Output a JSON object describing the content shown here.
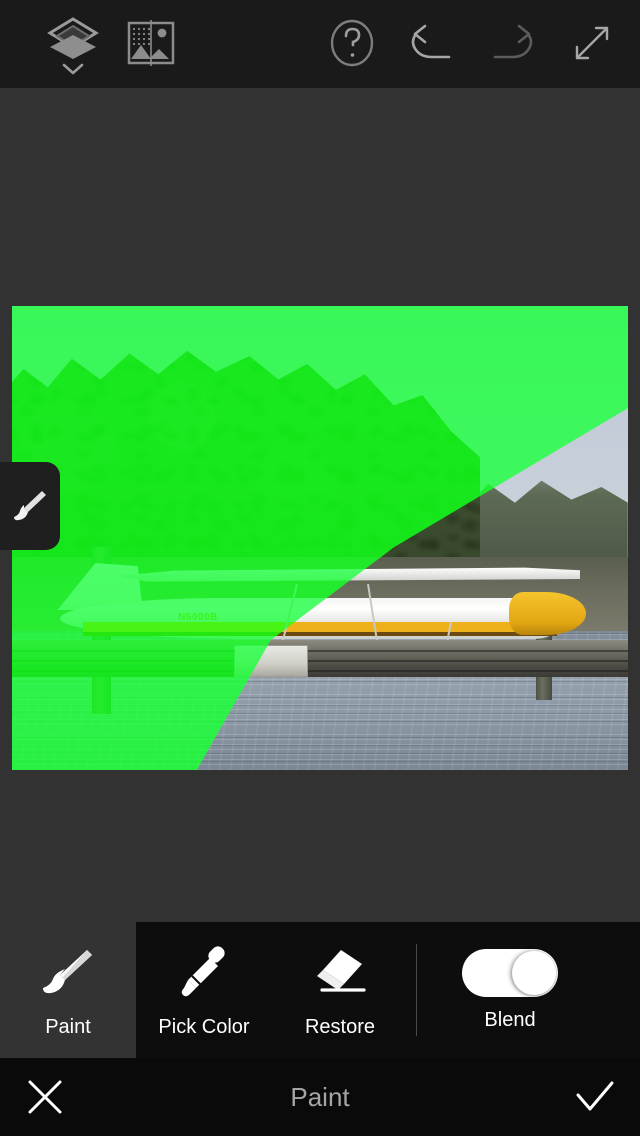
{
  "app": {
    "screen_title": "Paint",
    "background_color": "#323232",
    "accent_overlay_color": "#1ee82e"
  },
  "topbar": {
    "layers_icon": "layers-icon",
    "layers_chevron_icon": "chevron-down-icon",
    "compare_icon": "before-after-icon",
    "help_icon": "help-circle-icon",
    "undo_icon": "undo-icon",
    "redo_icon": "redo-icon",
    "fullscreen_icon": "fullscreen-expand-icon"
  },
  "canvas": {
    "brush_tab_icon": "paintbrush-icon",
    "photo_alt": "seaplane-on-dock",
    "overlay_label": "green-mask-overlay",
    "plane_registration": "N5000B"
  },
  "toolbar": {
    "tools": [
      {
        "label": "Paint",
        "icon": "paintbrush-icon",
        "selected": true
      },
      {
        "label": "Pick Color",
        "icon": "eyedropper-icon",
        "selected": false
      },
      {
        "label": "Restore",
        "icon": "eraser-icon",
        "selected": false
      }
    ],
    "blend": {
      "label": "Blend",
      "enabled": true
    }
  },
  "bottombar": {
    "cancel_icon": "close-x-icon",
    "title": "Paint",
    "apply_icon": "checkmark-icon"
  }
}
